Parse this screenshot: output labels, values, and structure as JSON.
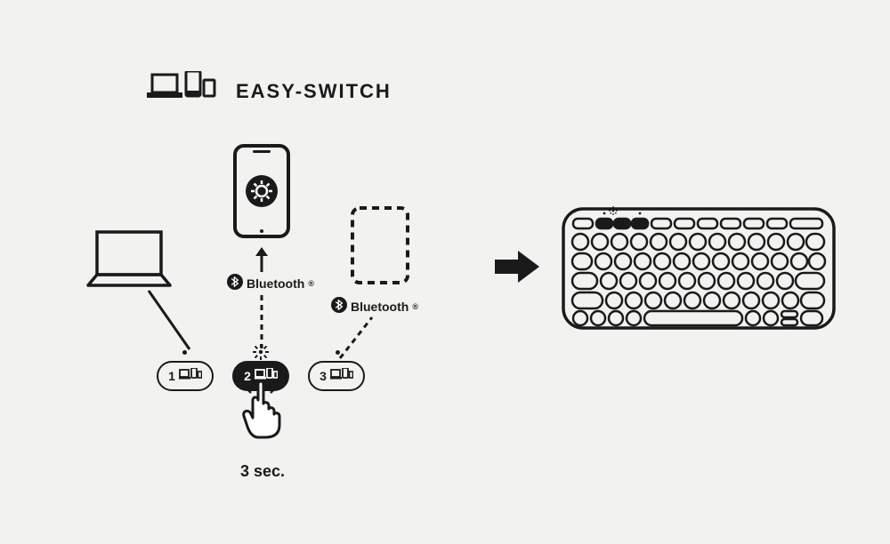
{
  "title": "EASY-SWITCH",
  "bluetooth_label_1": "Bluetooth",
  "bluetooth_label_2": "Bluetooth",
  "keys": {
    "k1": "1",
    "k2": "2",
    "k3": "3"
  },
  "duration_label": "3 sec.",
  "icons": {
    "title_icon": "devices-icon",
    "phone": "phone-settings-icon",
    "laptop": "laptop-icon",
    "dashed_device": "dashed-device-icon",
    "bt": "bluetooth-icon",
    "hand": "hand-press-icon",
    "arrow_right": "arrow-right-icon",
    "keyboard": "keyboard-icon",
    "sun": "blink-icon"
  }
}
